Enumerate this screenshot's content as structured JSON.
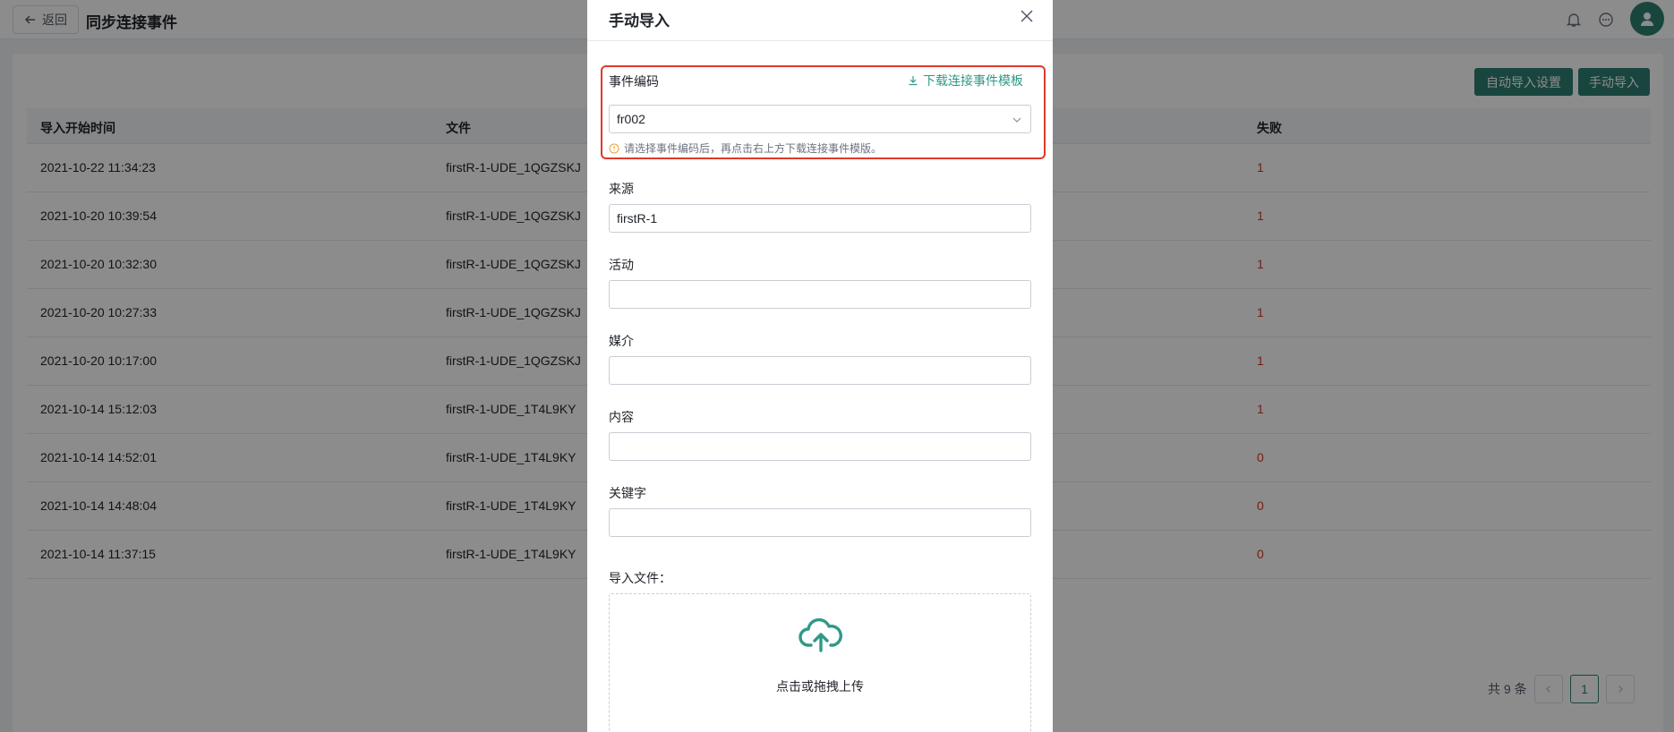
{
  "header": {
    "back_label": "返回",
    "title": "同步连接事件"
  },
  "toolbar": {
    "auto_import_settings": "自动导入设置",
    "manual_import": "手动导入"
  },
  "table": {
    "columns": [
      "导入开始时间",
      "文件",
      "失败"
    ],
    "rows": [
      {
        "time": "2021-10-22 11:34:23",
        "file": "firstR-1-UDE_1QGZSKJ",
        "fail": "1"
      },
      {
        "time": "2021-10-20 10:39:54",
        "file": "firstR-1-UDE_1QGZSKJ",
        "fail": "1"
      },
      {
        "time": "2021-10-20 10:32:30",
        "file": "firstR-1-UDE_1QGZSKJ",
        "fail": "1"
      },
      {
        "time": "2021-10-20 10:27:33",
        "file": "firstR-1-UDE_1QGZSKJ",
        "fail": "1"
      },
      {
        "time": "2021-10-20 10:17:00",
        "file": "firstR-1-UDE_1QGZSKJ",
        "fail": "1"
      },
      {
        "time": "2021-10-14 15:12:03",
        "file": "firstR-1-UDE_1T4L9KY",
        "fail": "1"
      },
      {
        "time": "2021-10-14 14:52:01",
        "file": "firstR-1-UDE_1T4L9KY",
        "fail": "0"
      },
      {
        "time": "2021-10-14 14:48:04",
        "file": "firstR-1-UDE_1T4L9KY",
        "fail": "0"
      },
      {
        "time": "2021-10-14 11:37:15",
        "file": "firstR-1-UDE_1T4L9KY",
        "fail": "0"
      }
    ]
  },
  "pagination": {
    "total_text": "共 9 条",
    "current_page": "1"
  },
  "modal": {
    "title": "手动导入",
    "event_code_label": "事件编码",
    "download_template": "下载连接事件模板",
    "event_code_value": "fr002",
    "hint": "请选择事件编码后，再点击右上方下载连接事件模版。",
    "source_label": "来源",
    "source_value": "firstR-1",
    "activity_label": "活动",
    "activity_value": "",
    "medium_label": "媒介",
    "medium_value": "",
    "content_label": "内容",
    "content_value": "",
    "keyword_label": "关键字",
    "keyword_value": "",
    "file_label": "导入文件：",
    "upload_text": "点击或拖拽上传"
  },
  "colors": {
    "primary": "#2f7f73",
    "link": "#2f9987",
    "fail": "#d9342b",
    "highlight": "#e0392b"
  }
}
